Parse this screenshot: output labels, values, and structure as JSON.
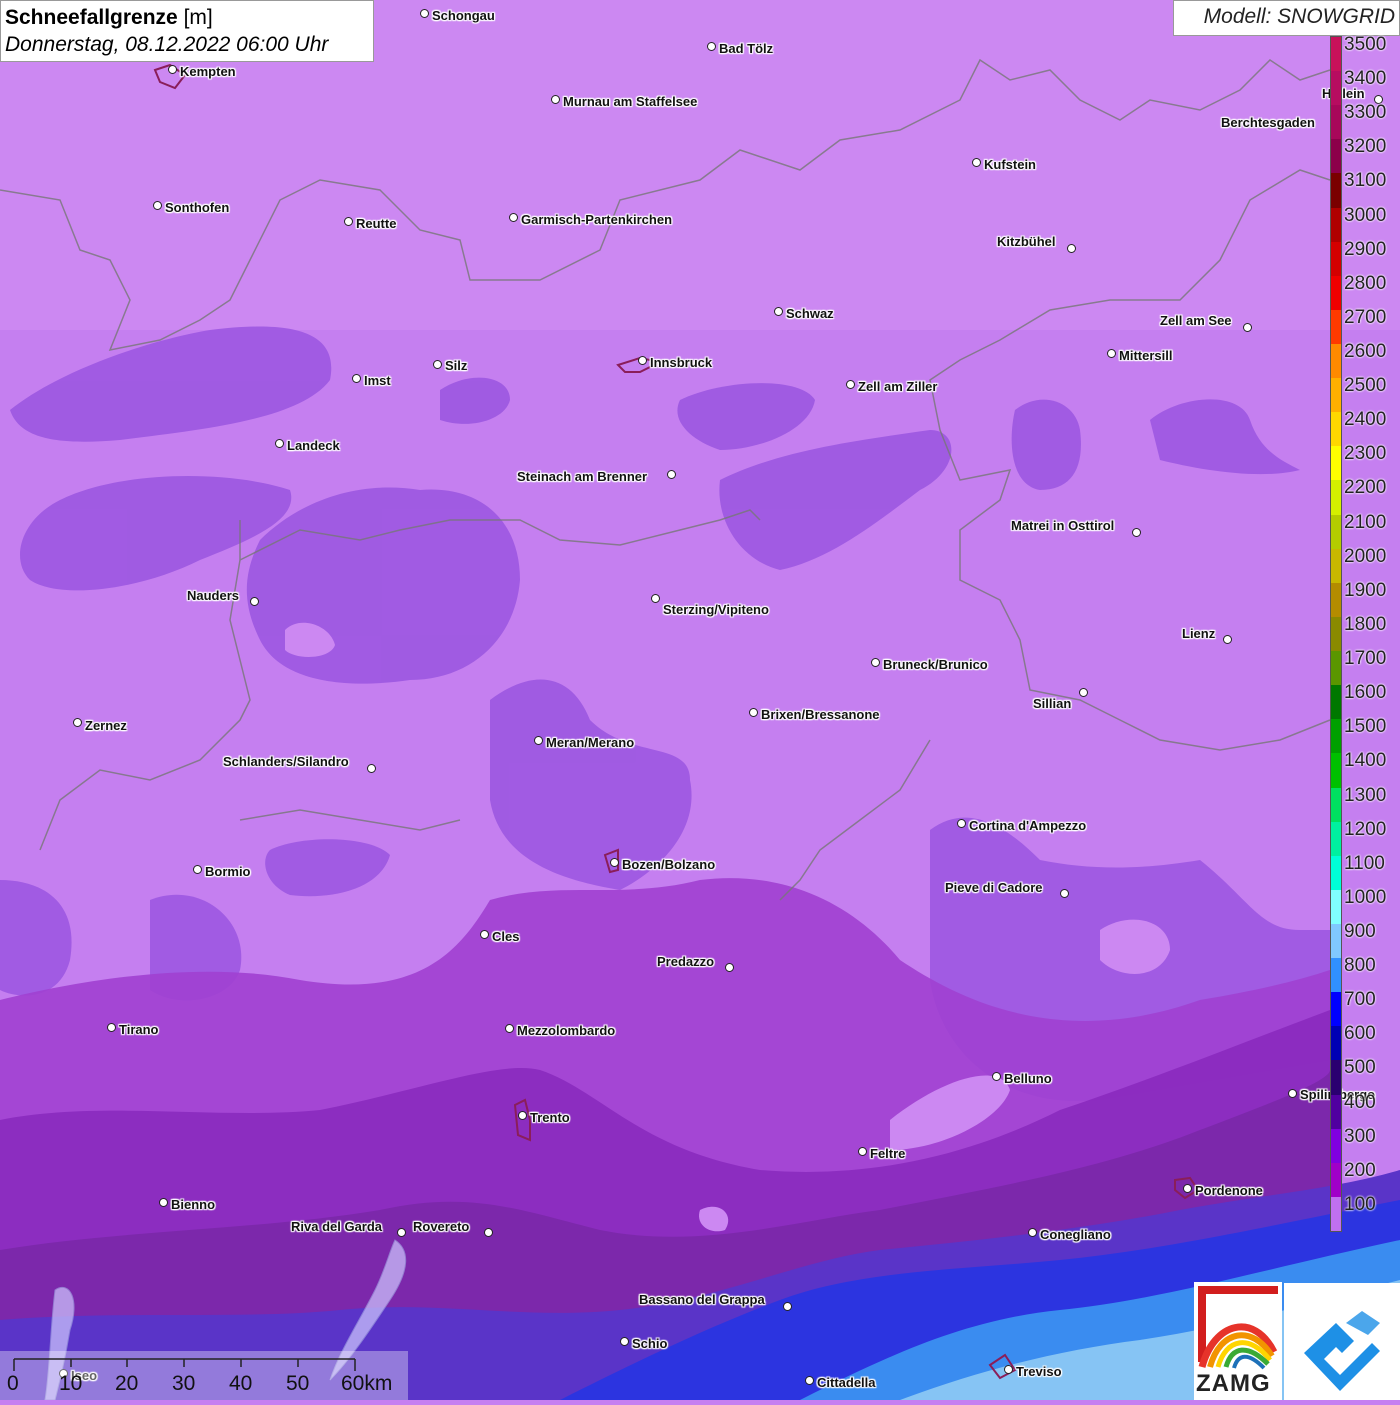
{
  "title": {
    "main": "Schneefallgrenze",
    "unit": "[m]",
    "datetime": "Donnerstag, 08.12.2022 06:00 Uhr"
  },
  "model": "Modell: SNOWGRID",
  "legend": [
    {
      "value": "3500",
      "color": "#c8115a"
    },
    {
      "value": "3400",
      "color": "#b70c60"
    },
    {
      "value": "3300",
      "color": "#a8075a"
    },
    {
      "value": "3200",
      "color": "#8c004a"
    },
    {
      "value": "3100",
      "color": "#7a0000"
    },
    {
      "value": "3000",
      "color": "#b00000"
    },
    {
      "value": "2900",
      "color": "#d40000"
    },
    {
      "value": "2800",
      "color": "#f00000"
    },
    {
      "value": "2700",
      "color": "#ff3a00"
    },
    {
      "value": "2600",
      "color": "#ff8a00"
    },
    {
      "value": "2500",
      "color": "#ffb000"
    },
    {
      "value": "2400",
      "color": "#ffd800"
    },
    {
      "value": "2300",
      "color": "#ffff00"
    },
    {
      "value": "2200",
      "color": "#d4f000"
    },
    {
      "value": "2100",
      "color": "#b4cc00"
    },
    {
      "value": "2000",
      "color": "#c8b800"
    },
    {
      "value": "1900",
      "color": "#b48c00"
    },
    {
      "value": "1800",
      "color": "#8a8a00"
    },
    {
      "value": "1700",
      "color": "#5a9600"
    },
    {
      "value": "1600",
      "color": "#007800"
    },
    {
      "value": "1500",
      "color": "#00a000"
    },
    {
      "value": "1400",
      "color": "#00c000"
    },
    {
      "value": "1300",
      "color": "#00e060"
    },
    {
      "value": "1200",
      "color": "#00f0a0"
    },
    {
      "value": "1100",
      "color": "#00ffd8"
    },
    {
      "value": "1000",
      "color": "#80ffff"
    },
    {
      "value": "900",
      "color": "#80c8ff"
    },
    {
      "value": "800",
      "color": "#3090ff"
    },
    {
      "value": "700",
      "color": "#0000ff"
    },
    {
      "value": "600",
      "color": "#0000b4"
    },
    {
      "value": "500",
      "color": "#2a0070"
    },
    {
      "value": "400",
      "color": "#5000a0"
    },
    {
      "value": "300",
      "color": "#8000e0"
    },
    {
      "value": "200",
      "color": "#a000c8"
    },
    {
      "value": "100",
      "color": "#c070f0"
    }
  ],
  "cities": [
    {
      "name": "Schongau"
    },
    {
      "name": "Kempten"
    },
    {
      "name": "Bad Tölz"
    },
    {
      "name": "Murnau am Staffelsee"
    },
    {
      "name": "Berchtesgaden"
    },
    {
      "name": "Kufstein"
    },
    {
      "name": "Sonthofen"
    },
    {
      "name": "Reutte"
    },
    {
      "name": "Garmisch-Partenkirchen"
    },
    {
      "name": "Kitzbühel"
    },
    {
      "name": "Schwaz"
    },
    {
      "name": "Zell am See"
    },
    {
      "name": "Innsbruck"
    },
    {
      "name": "Mittersill"
    },
    {
      "name": "Silz"
    },
    {
      "name": "Imst"
    },
    {
      "name": "Zell am Ziller"
    },
    {
      "name": "Landeck"
    },
    {
      "name": "Steinach am Brenner"
    },
    {
      "name": "Matrei in Osttirol"
    },
    {
      "name": "Nauders"
    },
    {
      "name": "Sterzing/Vipiteno"
    },
    {
      "name": "Lienz"
    },
    {
      "name": "Bruneck/Brunico"
    },
    {
      "name": "Sillian"
    },
    {
      "name": "Zernez"
    },
    {
      "name": "Brixen/Bressanone"
    },
    {
      "name": "Meran/Merano"
    },
    {
      "name": "Schlanders/Silandro"
    },
    {
      "name": "Cortina d'Ampezzo"
    },
    {
      "name": "Bozen/Bolzano"
    },
    {
      "name": "Bormio"
    },
    {
      "name": "Pieve di Cadore"
    },
    {
      "name": "Cles"
    },
    {
      "name": "Predazzo"
    },
    {
      "name": "Tirano"
    },
    {
      "name": "Mezzolombardo"
    },
    {
      "name": "Belluno"
    },
    {
      "name": "Spilimbergo"
    },
    {
      "name": "Trento"
    },
    {
      "name": "Feltre"
    },
    {
      "name": "Pordenone"
    },
    {
      "name": "Bienno"
    },
    {
      "name": "Riva del Garda"
    },
    {
      "name": "Rovereto"
    },
    {
      "name": "Conegliano"
    },
    {
      "name": "Bassano del Grappa"
    },
    {
      "name": "Schio"
    },
    {
      "name": "Treviso"
    },
    {
      "name": "Cittadella"
    },
    {
      "name": "Iseo"
    },
    {
      "name": "Hallein"
    }
  ],
  "scale": {
    "labels": [
      "0",
      "10",
      "20",
      "30",
      "40",
      "50",
      "60km"
    ]
  },
  "logos": {
    "zamg": "ZAMG"
  }
}
